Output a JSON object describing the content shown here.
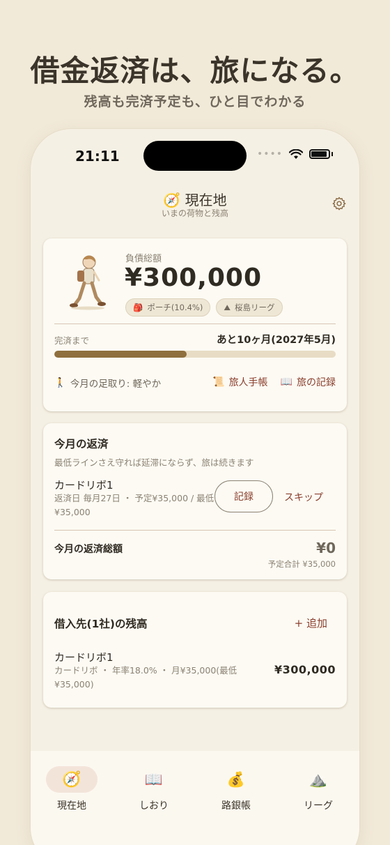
{
  "promo": {
    "headline": "借金返済は、旅になる。",
    "subline": "残高も完済予定も、ひと目でわかる"
  },
  "status_bar": {
    "time": "21:11"
  },
  "header": {
    "title": "現在地",
    "subtitle": "いまの荷物と残高",
    "title_icon": "compass-icon",
    "settings_icon": "gear-icon"
  },
  "summary": {
    "debt_label": "負債総額",
    "debt_amount": "¥300,000",
    "tags": [
      {
        "icon": "backpack-icon",
        "label": "ポーチ(10.4%)"
      },
      {
        "icon": "mountain-icon",
        "label": "桜島リーグ"
      }
    ],
    "payoff_label": "完済まで",
    "payoff_value": "あと10ヶ月(2027年5月)",
    "progress_fraction": 0.47,
    "pace_text": "今月の足取り: 軽やか",
    "links": [
      {
        "icon": "scroll-icon",
        "label": "旅人手帳"
      },
      {
        "icon": "book-icon",
        "label": "旅の記録"
      }
    ]
  },
  "monthly": {
    "title": "今月の返済",
    "subtitle": "最低ラインさえ守れば延滞にならず、旅は続きます",
    "loan_name": "カードリボ1",
    "loan_detail": "返済日 毎月27日 ・ 予定¥35,000 / 最低¥35,000",
    "record_label": "記録",
    "skip_label": "スキップ",
    "total_label": "今月の返済総額",
    "total_value": "¥0",
    "total_sub": "予定合計 ¥35,000"
  },
  "lenders": {
    "title": "借入先(1社)の残高",
    "add_label": "+ 追加",
    "items": [
      {
        "name": "カードリボ1",
        "detail": "カードリボ ・ 年率18.0% ・ 月¥35,000(最低¥35,000)",
        "amount": "¥300,000"
      }
    ]
  },
  "tabbar": {
    "tabs": [
      {
        "label": "現在地",
        "icon": "compass-icon",
        "active": true
      },
      {
        "label": "しおり",
        "icon": "book-icon",
        "active": false
      },
      {
        "label": "路銀帳",
        "icon": "money-bag-icon",
        "active": false
      },
      {
        "label": "リーグ",
        "icon": "mountain-icon",
        "active": false
      }
    ]
  },
  "colors": {
    "background": "#f2ead9",
    "accent": "#8a3e2c",
    "progress": "#8f6f3e"
  }
}
